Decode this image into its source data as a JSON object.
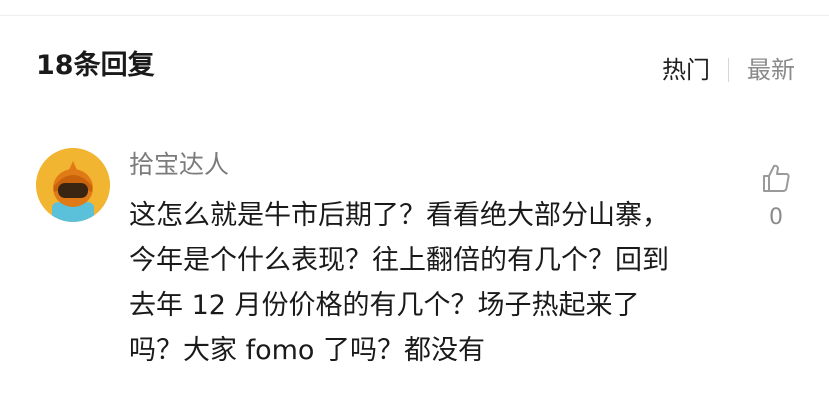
{
  "header": {
    "reply_count_label": "18条回复"
  },
  "sort_tabs": [
    {
      "label": "热门",
      "active": true
    },
    {
      "label": "最新",
      "active": false
    }
  ],
  "comment": {
    "author": "拾宝达人",
    "text": "这怎么就是牛市后期了？看看绝大部分山寨，\n今年是个什么表现？往上翻倍的有几个？回到\n去年 12 月份价格的有几个？场子热起来了\n吗？大家 fomo 了吗？都没有",
    "like_count": "0",
    "like_icon": "thumbs-up-icon",
    "avatar_icon": "helmet-avatar"
  },
  "colors": {
    "avatar_background": "#f1b531",
    "text_primary": "#1a1a1a",
    "text_secondary": "#8a8a8a"
  }
}
